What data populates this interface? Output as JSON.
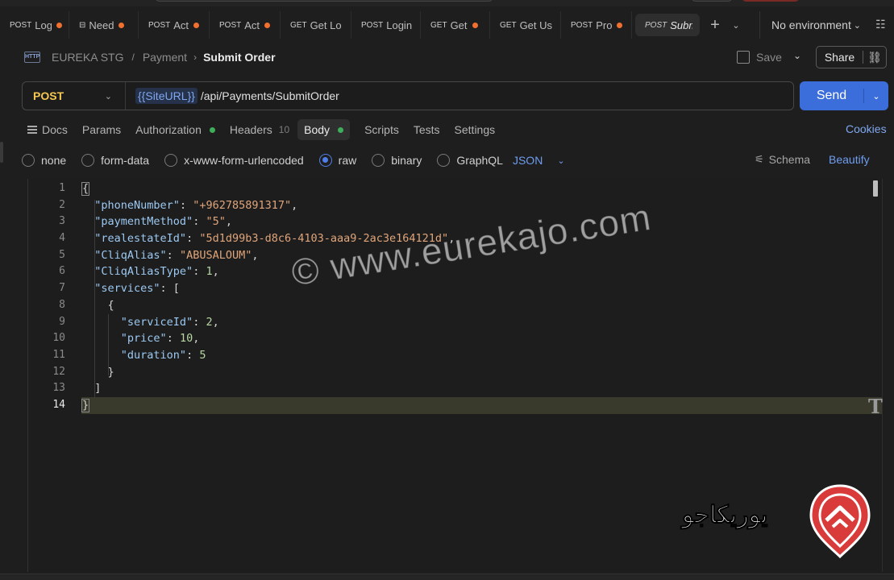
{
  "tabs": [
    {
      "method": "POST",
      "name": "Log",
      "dirty": true
    },
    {
      "method": "",
      "name": "Need",
      "dirty": true,
      "icon": "grpc-icon"
    },
    {
      "method": "POST",
      "name": "Act",
      "dirty": true
    },
    {
      "method": "POST",
      "name": "Act",
      "dirty": true
    },
    {
      "method": "GET",
      "name": "Get Lo",
      "dirty": false
    },
    {
      "method": "POST",
      "name": "Login",
      "dirty": false
    },
    {
      "method": "GET",
      "name": "Get",
      "dirty": true
    },
    {
      "method": "GET",
      "name": "Get Us",
      "dirty": false
    },
    {
      "method": "POST",
      "name": "Pro",
      "dirty": true
    },
    {
      "method": "POST",
      "name": "Subm",
      "dirty": false,
      "active": true
    }
  ],
  "environment": {
    "label": "No environment"
  },
  "breadcrumb": {
    "workspace": "EUREKA STG",
    "collection": "Payment",
    "request": "Submit Order"
  },
  "toolbar": {
    "save_label": "Save",
    "share_label": "Share"
  },
  "request": {
    "method": "POST",
    "url_variable": "{{SiteURL}}",
    "url_path": "/api/Payments/SubmitOrder",
    "send_label": "Send"
  },
  "request_tabs": {
    "docs": "Docs",
    "params": "Params",
    "authorization": "Authorization",
    "headers": "Headers",
    "headers_count": "10",
    "body": "Body",
    "scripts": "Scripts",
    "tests": "Tests",
    "settings": "Settings",
    "cookies": "Cookies"
  },
  "body_options": {
    "none": "none",
    "form_data": "form-data",
    "urlencoded": "x-www-form-urlencoded",
    "raw": "raw",
    "binary": "binary",
    "graphql": "GraphQL",
    "format": "JSON",
    "selected": "raw",
    "schema": "Schema",
    "beautify": "Beautify"
  },
  "editor": {
    "line_numbers": [
      "1",
      "2",
      "3",
      "4",
      "5",
      "6",
      "7",
      "8",
      "9",
      "10",
      "11",
      "12",
      "13",
      "14"
    ],
    "current_line": 14,
    "fields": {
      "phoneNumber_key": "\"phoneNumber\"",
      "phoneNumber_val": "\"+962785891317\"",
      "paymentMethod_key": "\"paymentMethod\"",
      "paymentMethod_val": "\"5\"",
      "realestateId_key": "\"realestateId\"",
      "realestateId_val": "\"5d1d99b3-d8c6-4103-aaa9-2ac3e164121d\"",
      "cliqAlias_key": "\"CliqAlias\"",
      "cliqAlias_val": "\"ABUSALOUM\"",
      "cliqAliasType_key": "\"CliqAliasType\"",
      "cliqAliasType_val": "1",
      "services_key": "\"services\"",
      "serviceId_key": "\"serviceId\"",
      "serviceId_val": "2",
      "price_key": "\"price\"",
      "price_val": "10",
      "duration_key": "\"duration\"",
      "duration_val": "5"
    }
  },
  "watermark": {
    "text": "© www.eurekajo.com",
    "logo_text": "يوريكاجو"
  },
  "colors": {
    "accent": "#3b6ddb",
    "method_post": "#f5c751",
    "link": "#6f9df0",
    "dirty_dot": "#f2702f",
    "status_dot": "#3fae5a"
  }
}
